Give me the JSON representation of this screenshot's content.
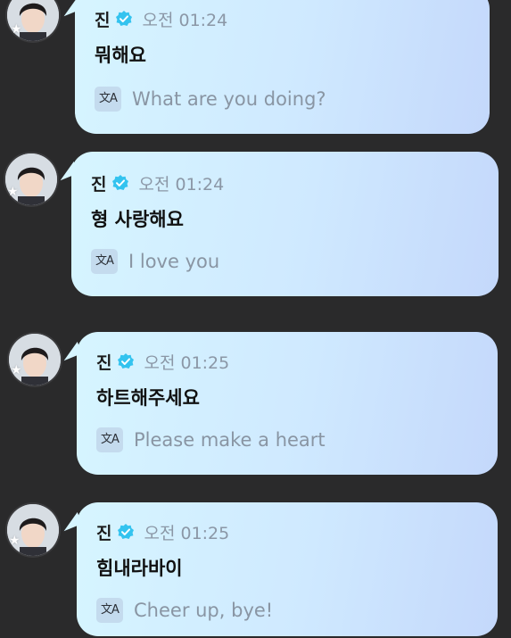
{
  "colors": {
    "background": "#2a2a2b",
    "bubble_start": "#d6f5ff",
    "bubble_end": "#c4d8fb",
    "verified_badge": "#33c3ef",
    "timestamp": "#8b97a6",
    "translation": "#8995a3"
  },
  "messages": [
    {
      "sender": "진",
      "verified_icon": "verified-badge-icon",
      "time": "오전 01:24",
      "text": "뭐해요",
      "translate_icon_label": "文A",
      "translation": "What are you doing?"
    },
    {
      "sender": "진",
      "verified_icon": "verified-badge-icon",
      "time": "오전 01:24",
      "text": "형 사랑해요",
      "translate_icon_label": "文A",
      "translation": "I love you"
    },
    {
      "sender": "진",
      "verified_icon": "verified-badge-icon",
      "time": "오전 01:25",
      "text": "하트해주세요",
      "translate_icon_label": "文A",
      "translation": "Please make a heart"
    },
    {
      "sender": "진",
      "verified_icon": "verified-badge-icon",
      "time": "오전 01:25",
      "text": "힘내라바이",
      "translate_icon_label": "文A",
      "translation": "Cheer up, bye!"
    }
  ]
}
